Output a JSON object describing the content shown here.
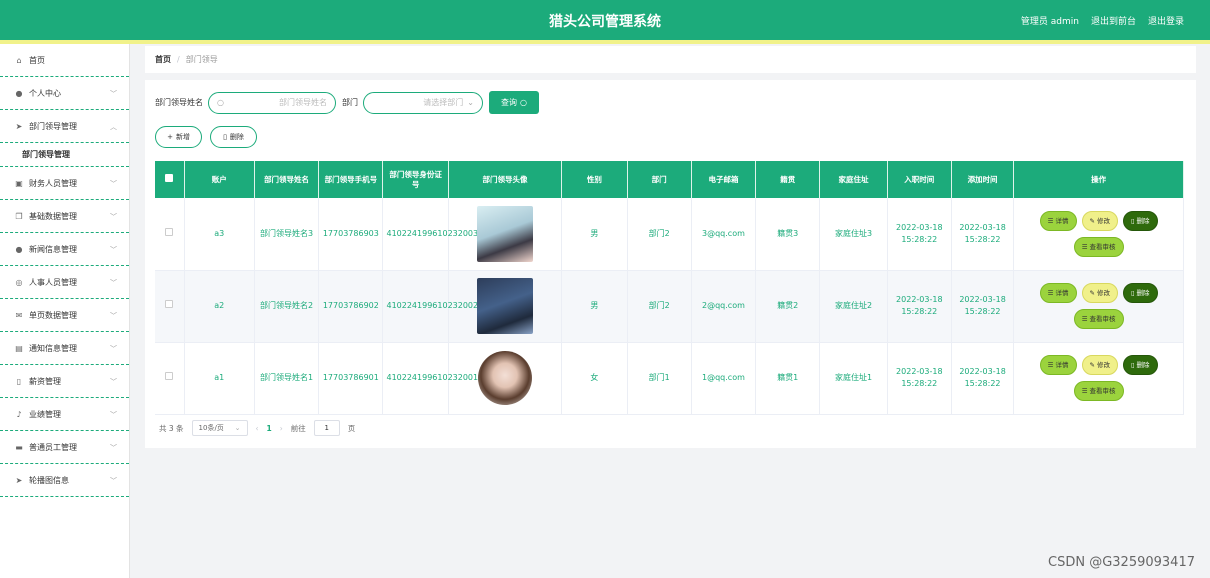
{
  "header": {
    "title": "猎头公司管理系统",
    "admin": "管理员 admin",
    "to_front": "退出到前台",
    "logout": "退出登录"
  },
  "sidebar": {
    "items": [
      {
        "label": "首页",
        "icon": "home-icon",
        "glyph": "⌂"
      },
      {
        "label": "个人中心",
        "icon": "user-icon",
        "glyph": "●"
      },
      {
        "label": "部门领导管理",
        "icon": "send-icon",
        "glyph": "➤",
        "expanded": true,
        "sub": "部门领导管理"
      },
      {
        "label": "财务人员管理",
        "icon": "briefcase-icon",
        "glyph": "▣"
      },
      {
        "label": "基础数据管理",
        "icon": "copy-icon",
        "glyph": "❐"
      },
      {
        "label": "新闻信息管理",
        "icon": "user-icon",
        "glyph": "●"
      },
      {
        "label": "人事人员管理",
        "icon": "globe-icon",
        "glyph": "◎"
      },
      {
        "label": "单页数据管理",
        "icon": "mail-icon",
        "glyph": "✉"
      },
      {
        "label": "通知信息管理",
        "icon": "notebook-icon",
        "glyph": "▤"
      },
      {
        "label": "薪资管理",
        "icon": "stopwatch-icon",
        "glyph": "▯"
      },
      {
        "label": "业绩管理",
        "icon": "microphone-icon",
        "glyph": "♪"
      },
      {
        "label": "普通员工管理",
        "icon": "ticket-icon",
        "glyph": "▬"
      },
      {
        "label": "轮播图信息",
        "icon": "send-icon",
        "glyph": "➤"
      }
    ]
  },
  "breadcrumb": {
    "home": "首页",
    "separator": "/",
    "current": "部门领导"
  },
  "search": {
    "name_label": "部门领导姓名",
    "name_placeholder": "部门领导姓名",
    "dept_label": "部门",
    "dept_placeholder": "请选择部门",
    "query_button": "查询"
  },
  "actions": {
    "add": "新增",
    "delete": "删除"
  },
  "table": {
    "headers": [
      "账户",
      "部门领导姓名",
      "部门领导手机号",
      "部门领导身份证号",
      "部门领导头像",
      "性别",
      "部门",
      "电子邮箱",
      "籍贯",
      "家庭住址",
      "入职时间",
      "添加时间",
      "操作"
    ],
    "rows": [
      {
        "account": "a3",
        "name": "部门领导姓名3",
        "phone": "17703786903",
        "id_card": "410224199610232003",
        "gender": "男",
        "dept": "部门2",
        "email": "3@qq.com",
        "origin": "籍贯3",
        "address": "家庭住址3",
        "hire": "2022-03-18 15:28:22",
        "added": "2022-03-18 15:28:22"
      },
      {
        "account": "a2",
        "name": "部门领导姓名2",
        "phone": "17703786902",
        "id_card": "410224199610232002",
        "gender": "男",
        "dept": "部门2",
        "email": "2@qq.com",
        "origin": "籍贯2",
        "address": "家庭住址2",
        "hire": "2022-03-18 15:28:22",
        "added": "2022-03-18 15:28:22"
      },
      {
        "account": "a1",
        "name": "部门领导姓名1",
        "phone": "17703786901",
        "id_card": "410224199610232001",
        "gender": "女",
        "dept": "部门1",
        "email": "1@qq.com",
        "origin": "籍贯1",
        "address": "家庭住址1",
        "hire": "2022-03-18 15:28:22",
        "added": "2022-03-18 15:28:22"
      }
    ],
    "ops": {
      "detail": "详情",
      "edit": "修改",
      "delete": "删除",
      "audit": "查看审核"
    }
  },
  "pager": {
    "total": "共 3 条",
    "size": "10条/页",
    "current": "1",
    "goto": "前往",
    "goto_value": "1",
    "page_unit": "页"
  },
  "watermark": "CSDN @G3259093417",
  "colors": {
    "primary": "#1cab7b",
    "accent_yellow": "#f1f28a",
    "detail": "#9bd33d",
    "edit": "#f0f08a",
    "delete": "#2e6a0c"
  }
}
